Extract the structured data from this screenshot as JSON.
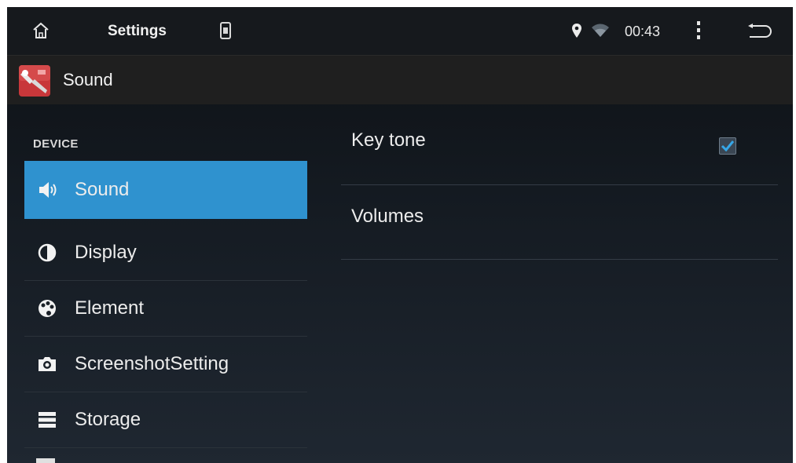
{
  "status_bar": {
    "app_title": "Settings",
    "time": "00:43",
    "icons": [
      "home-icon",
      "sim-card-icon",
      "location-icon",
      "wifi-icon",
      "overflow-menu-icon",
      "back-icon"
    ]
  },
  "action_bar": {
    "title": "Sound",
    "icon": "settings-tools-icon"
  },
  "sidebar": {
    "section": "DEVICE",
    "items": [
      {
        "label": "Sound",
        "icon": "speaker-icon",
        "selected": true
      },
      {
        "label": "Display",
        "icon": "brightness-icon",
        "selected": false
      },
      {
        "label": "Element",
        "icon": "palette-icon",
        "selected": false
      },
      {
        "label": "ScreenshotSetting",
        "icon": "camera-icon",
        "selected": false
      },
      {
        "label": "Storage",
        "icon": "storage-icon",
        "selected": false
      }
    ]
  },
  "content": {
    "items": [
      {
        "title": "Key tone",
        "checked": true
      },
      {
        "title": "Volumes"
      }
    ]
  },
  "colors": {
    "accent": "#2f92cf",
    "status_bar_bg": "#16191d",
    "action_bar_bg": "#1f1f1f",
    "text": "#ececec"
  }
}
